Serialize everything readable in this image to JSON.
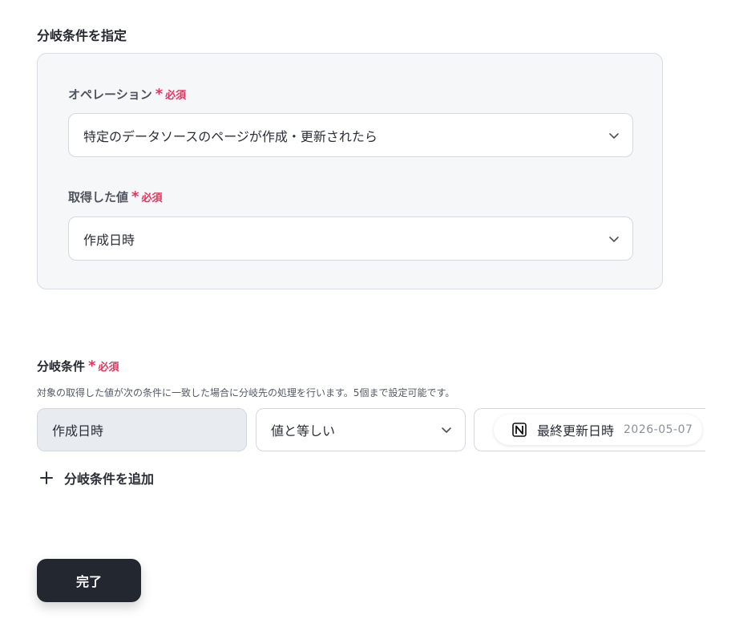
{
  "section": {
    "title": "分岐条件を指定"
  },
  "operation": {
    "label": "オペレーション",
    "required_mark": "*",
    "required_text": "必須",
    "selected": "特定のデータソースのページが作成・更新されたら"
  },
  "acquired_value": {
    "label": "取得した値",
    "required_mark": "*",
    "required_text": "必須",
    "selected": "作成日時"
  },
  "branch_condition": {
    "label": "分岐条件",
    "required_mark": "*",
    "required_text": "必須",
    "description": "対象の取得した値が次の条件に一致した場合に分岐先の処理を行います。5個まで設定可能です。",
    "field": "作成日時",
    "operator": "値と等しい",
    "value_chip": {
      "icon": "notion-icon",
      "label": "最終更新日時",
      "date": "2026-05-07"
    },
    "add_label": "分岐条件を追加"
  },
  "footer": {
    "done_label": "完了"
  },
  "colors": {
    "required": "#e0355d",
    "card_bg": "#f6f7f9",
    "button_bg": "#23272f"
  }
}
